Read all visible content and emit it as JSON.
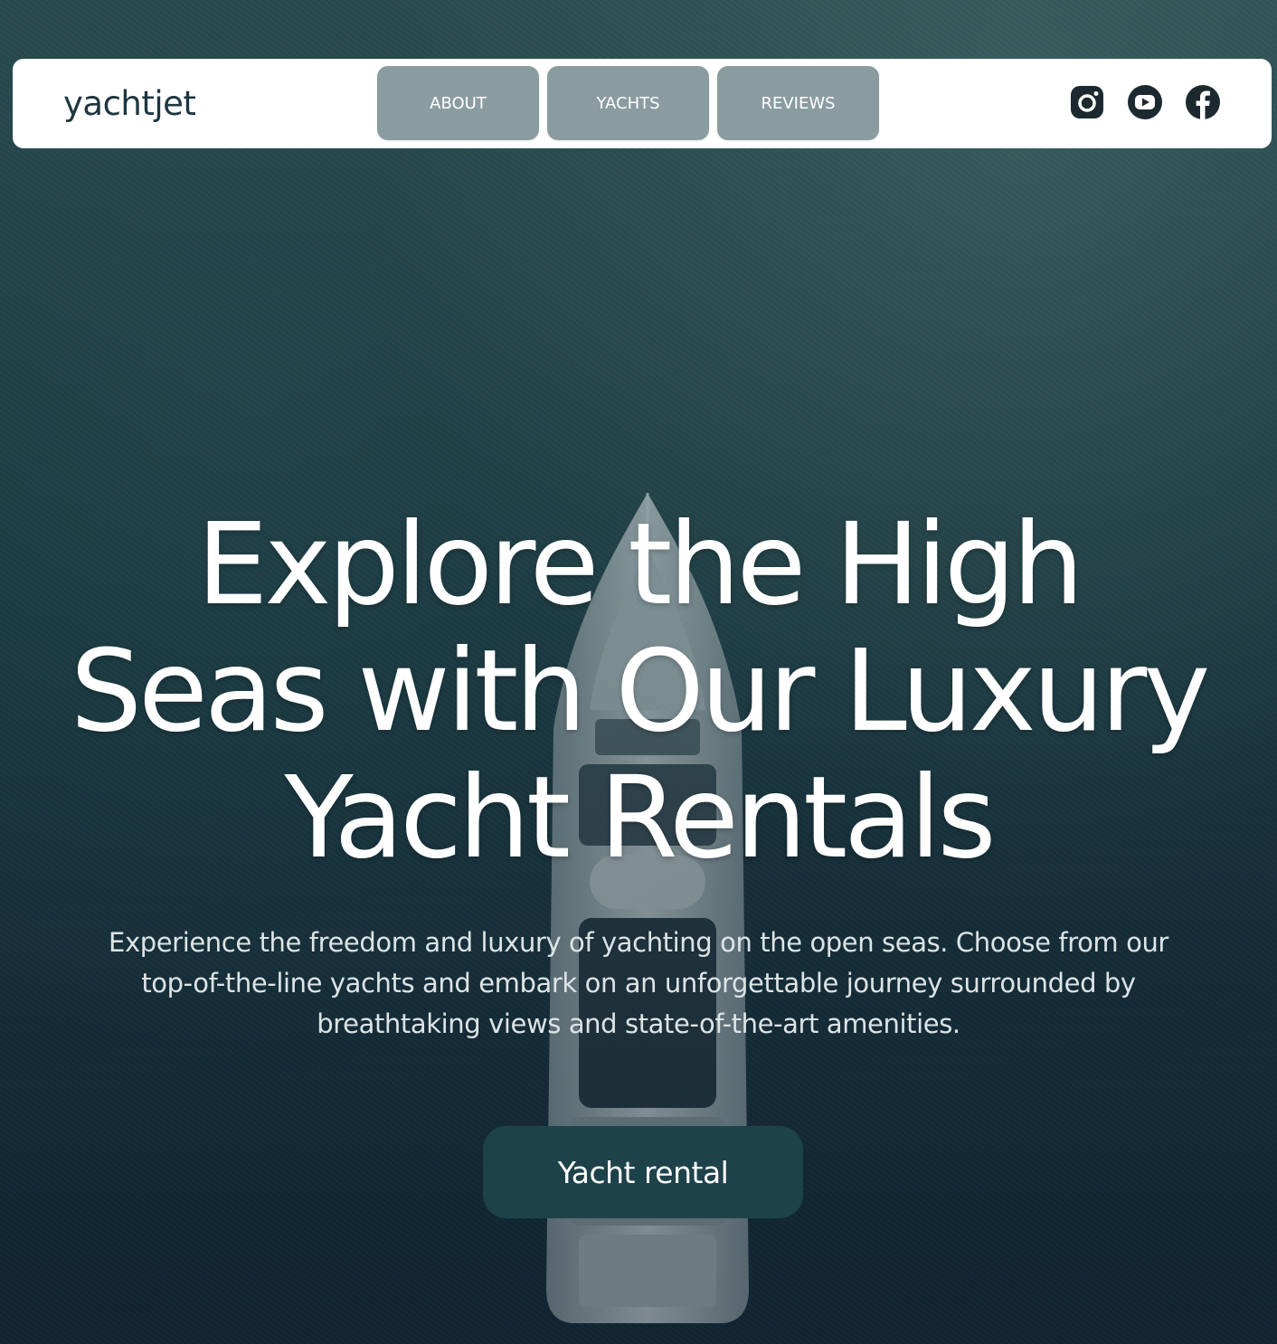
{
  "header": {
    "logo": "yachtjet",
    "nav": [
      {
        "label": "ABOUT"
      },
      {
        "label": "YACHTS"
      },
      {
        "label": "REVIEWS"
      }
    ],
    "socials": [
      {
        "icon": "instagram-icon"
      },
      {
        "icon": "youtube-icon"
      },
      {
        "icon": "facebook-icon"
      }
    ]
  },
  "hero": {
    "headline_line1": "Explore the High",
    "headline_line2": "Seas with Our Luxury",
    "headline_line3": "Yacht Rentals",
    "subtitle": "Experience the freedom and luxury of yachting on the open seas. Choose from our top-of-the-line yachts and embark on an unforgettable journey surrounded by breathtaking views and state-of-the-art amenities.",
    "cta_label": "Yacht rental"
  },
  "colors": {
    "nav_button": "#8a9ca0",
    "cta_background": "#1e424a",
    "logo_text": "#1e3640"
  }
}
